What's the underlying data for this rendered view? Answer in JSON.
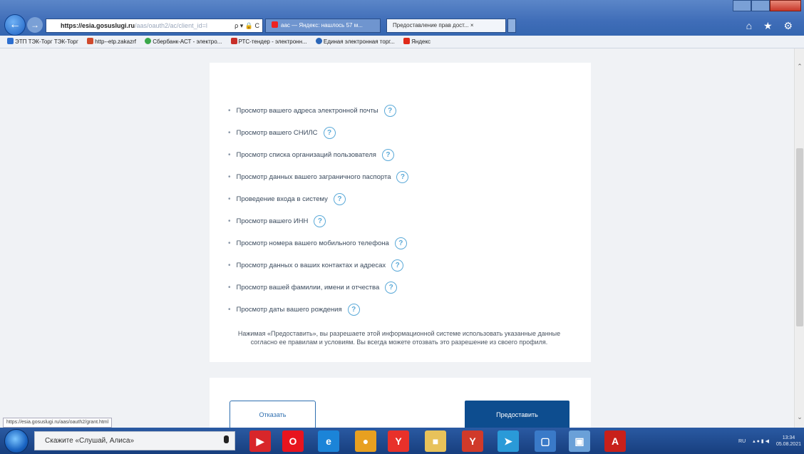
{
  "browser": {
    "url_main": "https://esia.gosuslugi.ru",
    "url_path": "/aas/oauth2/ac/client_id=l",
    "address_controls": "ρ ▾ 🔒 C",
    "tabs": [
      {
        "label": "aac — Яндекс: нашлось 57 м..."
      },
      {
        "label": "Предоставление прав дост... ×"
      }
    ],
    "tools_glyphs": "⌂ ★ ⚙"
  },
  "favorites": [
    {
      "label": "ЭТП ТЭК-Торг ТЭК-Торг",
      "color": "#2d6fd0"
    },
    {
      "label": "http--etp.zakazrf",
      "color": "#d04a2d"
    },
    {
      "label": "Сбербанк-АСТ - электро...",
      "color": "#3aa84a"
    },
    {
      "label": "РТС-тендер - электронн...",
      "color": "#c8302a"
    },
    {
      "label": "Единая электронная торг...",
      "color": "#2a66b8"
    },
    {
      "label": "Яндекс",
      "color": "#e02a1a"
    }
  ],
  "permissions": [
    "Просмотр вашего адреса электронной почты",
    "Просмотр вашего СНИЛС",
    "Просмотр списка организаций пользователя",
    "Просмотр данных вашего заграничного паспорта",
    "Проведение входа в систему",
    "Просмотр вашего ИНН",
    "Просмотр номера вашего мобильного телефона",
    "Просмотр данных о ваших контактах и адресах",
    "Просмотр вашей фамилии, имени и отчества",
    "Просмотр даты вашего рождения"
  ],
  "help_glyph": "?",
  "bullet_glyph": "•",
  "note": "Нажимая «Предоставить», вы разрешаете этой информационной системе использовать указанные данные согласно ее правилам и условиям. Вы всегда можете отозвать это разрешение из своего профиля.",
  "buttons": {
    "decline": "Отказать",
    "grant": "Предоставить"
  },
  "status_url": "https://esia.gosuslugi.ru/aas/oauth2/grant.html",
  "taskbar": {
    "search_placeholder": "Скажите «Слушай, Алиса»",
    "apps": [
      {
        "name": "video-app-icon",
        "color": "#d8262a",
        "glyph": "▶"
      },
      {
        "name": "opera-icon",
        "color": "#e8141f",
        "glyph": "O"
      },
      {
        "name": "internet-explorer-icon",
        "color": "#1b84d8",
        "glyph": "e"
      },
      {
        "name": "chrome-icon",
        "color": "#e8a020",
        "glyph": "●"
      },
      {
        "name": "yandex-browser-icon",
        "color": "#e8312a",
        "glyph": "Y"
      },
      {
        "name": "folder-icon",
        "color": "#e8c25a",
        "glyph": "■"
      },
      {
        "name": "yandex-icon",
        "color": "#d03a2a",
        "glyph": "Y"
      },
      {
        "name": "telegram-icon",
        "color": "#2a9ad8",
        "glyph": "➤"
      },
      {
        "name": "window-app-icon",
        "color": "#3a7ac8",
        "glyph": "▢"
      },
      {
        "name": "image-viewer-icon",
        "color": "#6aa0d8",
        "glyph": "▣"
      },
      {
        "name": "acrobat-icon",
        "color": "#c8201a",
        "glyph": "A"
      }
    ],
    "lang": "RU",
    "tray_glyphs": "▴ ● ▮ ◀",
    "time": "13:34",
    "date": "05.08.2021"
  }
}
